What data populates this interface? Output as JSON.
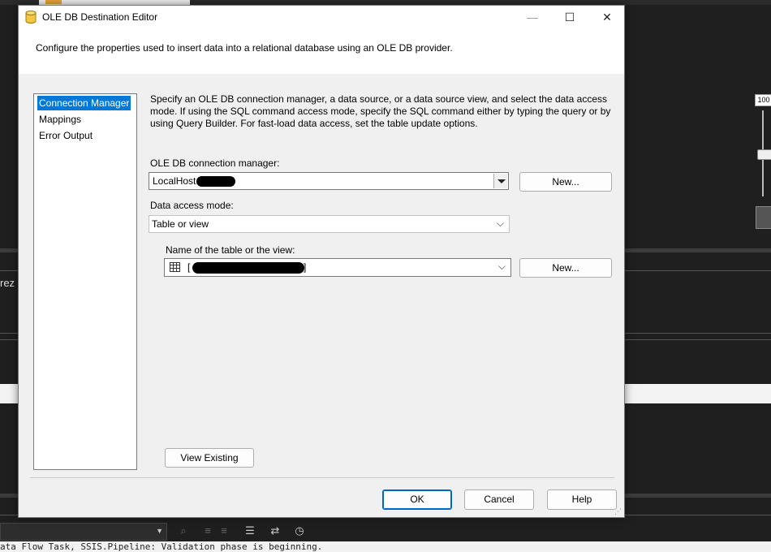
{
  "dialog": {
    "title": "OLE DB Destination Editor",
    "header_description": "Configure the properties used to insert data into a relational database using an OLE DB provider.",
    "nav": [
      {
        "label": "Connection Manager",
        "selected": true
      },
      {
        "label": "Mappings",
        "selected": false
      },
      {
        "label": "Error Output",
        "selected": false
      }
    ],
    "intro": "Specify an OLE DB connection manager, a data source, or a data source view, and select the data access mode. If using the SQL command access mode, specify the SQL command either by typing the query or by using Query Builder. For fast-load data access, set the table update options.",
    "connection_manager": {
      "label": "OLE DB connection manager:",
      "value": "LocalHost.",
      "new_button": "New..."
    },
    "data_access_mode": {
      "label": "Data access mode:",
      "value": "Table or view"
    },
    "table_name": {
      "label": "Name of the table or the view:",
      "value_prefix": "[",
      "value_suffix": "]",
      "new_button": "New..."
    },
    "view_existing_button": "View Existing",
    "footer": {
      "ok": "OK",
      "cancel": "Cancel",
      "help": "Help"
    }
  },
  "background": {
    "side_text": "rez",
    "zoom_level": "100",
    "output_line": "ata Flow Task, SSIS.Pipeline: Validation phase is beginning."
  },
  "colors": {
    "selection": "#0078d7",
    "default_button_border": "#0067c0"
  }
}
